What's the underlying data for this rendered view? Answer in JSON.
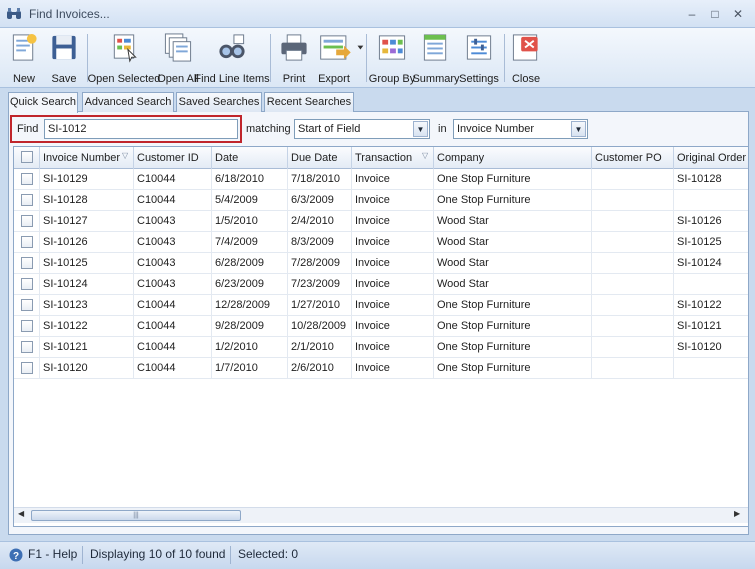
{
  "window": {
    "title": "Find Invoices..."
  },
  "toolbar": {
    "new": "New",
    "save": "Save",
    "open_selected": "Open Selected",
    "open_all": "Open All",
    "find_line_items": "Find Line Items",
    "print": "Print",
    "export": "Export",
    "group_by": "Group By",
    "summary": "Summary",
    "settings": "Settings",
    "close": "Close"
  },
  "tabs": [
    "Quick Search",
    "Advanced Search",
    "Saved Searches",
    "Recent Searches"
  ],
  "search": {
    "find_label": "Find",
    "find_value": "SI-1012",
    "matching_label": "matching",
    "matching_value": "Start of Field",
    "in_label": "in",
    "in_value": "Invoice Number"
  },
  "grid": {
    "columns": [
      "Invoice Number",
      "Customer ID",
      "Date",
      "Due Date",
      "Transaction",
      "Company",
      "Customer PO",
      "Original Order"
    ],
    "rows": [
      [
        "SI-10129",
        "C10044",
        "6/18/2010",
        "7/18/2010",
        "Invoice",
        "One Stop Furniture",
        "",
        "SI-10128"
      ],
      [
        "SI-10128",
        "C10044",
        "5/4/2009",
        "6/3/2009",
        "Invoice",
        "One Stop Furniture",
        "",
        ""
      ],
      [
        "SI-10127",
        "C10043",
        "1/5/2010",
        "2/4/2010",
        "Invoice",
        "Wood Star",
        "",
        "SI-10126"
      ],
      [
        "SI-10126",
        "C10043",
        "7/4/2009",
        "8/3/2009",
        "Invoice",
        "Wood Star",
        "",
        "SI-10125"
      ],
      [
        "SI-10125",
        "C10043",
        "6/28/2009",
        "7/28/2009",
        "Invoice",
        "Wood Star",
        "",
        "SI-10124"
      ],
      [
        "SI-10124",
        "C10043",
        "6/23/2009",
        "7/23/2009",
        "Invoice",
        "Wood Star",
        "",
        ""
      ],
      [
        "SI-10123",
        "C10044",
        "12/28/2009",
        "1/27/2010",
        "Invoice",
        "One Stop Furniture",
        "",
        "SI-10122"
      ],
      [
        "SI-10122",
        "C10044",
        "9/28/2009",
        "10/28/2009",
        "Invoice",
        "One Stop Furniture",
        "",
        "SI-10121"
      ],
      [
        "SI-10121",
        "C10044",
        "1/2/2010",
        "2/1/2010",
        "Invoice",
        "One Stop Furniture",
        "",
        "SI-10120"
      ],
      [
        "SI-10120",
        "C10044",
        "1/7/2010",
        "2/6/2010",
        "Invoice",
        "One Stop Furniture",
        "",
        ""
      ]
    ]
  },
  "status": {
    "help": "F1 - Help",
    "displaying": "Displaying 10 of 10 found",
    "selected": "Selected: 0"
  },
  "colors": {
    "highlight_border": "#c0252b",
    "window_bg": "#c9daee",
    "panel_bg": "#f3f6fb"
  }
}
